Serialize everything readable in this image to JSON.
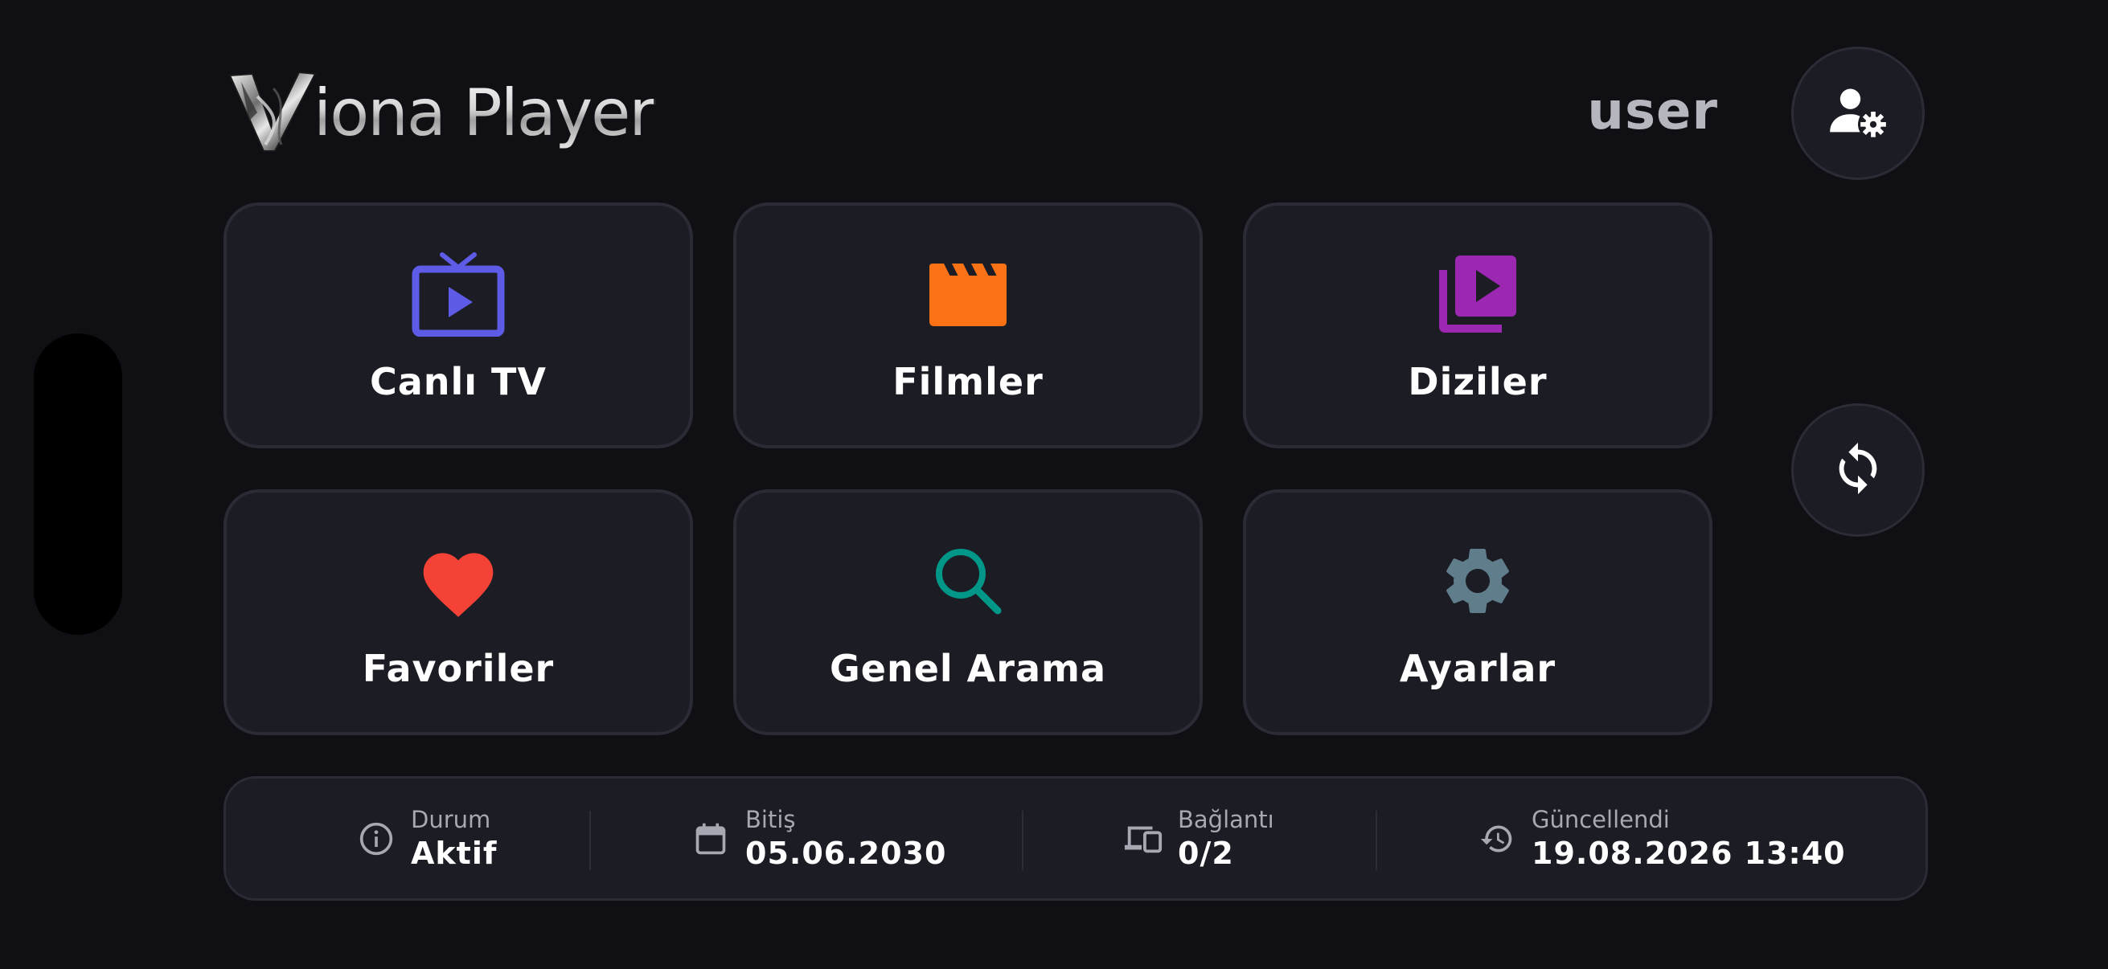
{
  "header": {
    "app_title": "iona Player",
    "logo_icon": "v-chrome-logo",
    "user_name": "user",
    "user_settings_icon": "user-gear-icon"
  },
  "menu": {
    "tiles": [
      {
        "label": "Canlı TV",
        "icon": "live-tv-icon",
        "color": "#5e5ce6"
      },
      {
        "label": "Filmler",
        "icon": "clapperboard-icon",
        "color": "#f97316"
      },
      {
        "label": "Diziler",
        "icon": "video-library-icon",
        "color": "#9c27b0"
      },
      {
        "label": "Favoriler",
        "icon": "heart-icon",
        "color": "#f44336"
      },
      {
        "label": "Genel Arama",
        "icon": "search-icon",
        "color": "#009688"
      },
      {
        "label": "Ayarlar",
        "icon": "gear-icon",
        "color": "#607d8b"
      }
    ]
  },
  "side_actions": {
    "refresh_icon": "refresh-icon"
  },
  "status": {
    "items": [
      {
        "label": "Durum",
        "value": "Aktif",
        "icon": "info-icon"
      },
      {
        "label": "Bitiş",
        "value": "05.06.2030",
        "icon": "calendar-icon"
      },
      {
        "label": "Bağlantı",
        "value": "0/2",
        "icon": "devices-icon"
      },
      {
        "label": "Güncellendi",
        "value": "19.08.2026 13:40",
        "icon": "history-icon"
      }
    ],
    "icon_color": "#a7a8b2"
  }
}
